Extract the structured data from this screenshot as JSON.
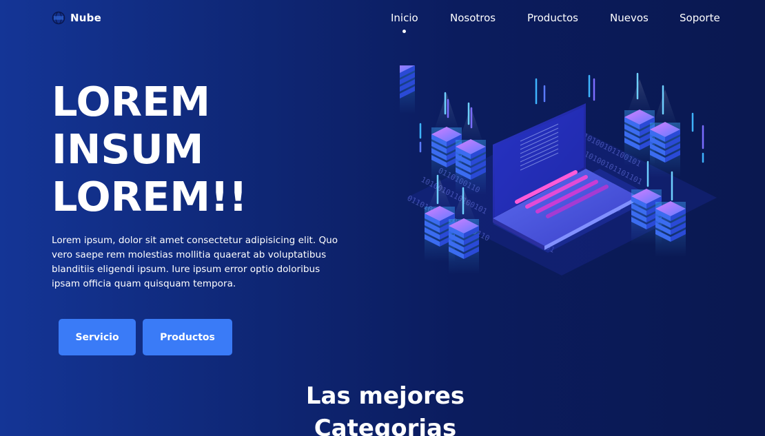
{
  "brand": {
    "name": "Nube",
    "icon": "globe-server-icon"
  },
  "nav": {
    "items": [
      {
        "label": "Inicio",
        "active": true
      },
      {
        "label": "Nosotros",
        "active": false
      },
      {
        "label": "Productos",
        "active": false
      },
      {
        "label": "Nuevos",
        "active": false
      },
      {
        "label": "Soporte",
        "active": false
      }
    ]
  },
  "hero": {
    "title_lines": [
      "LOREM",
      "INSUM",
      "LOREM!!"
    ],
    "text": "Lorem ipsum, dolor sit amet consectetur adipisicing elit. Quo vero saepe rem molestias mollitia quaerat ab voluptatibus blanditiis eligendi ipsum. Iure ipsum error optio doloribus ipsam officia quam quisquam tempora.",
    "buttons": {
      "primary": "Servicio",
      "secondary": "Productos"
    },
    "illustration": "isometric-cloud-servers-laptop-illustration"
  },
  "section": {
    "title_lines": [
      "Las mejores",
      "Categorias"
    ]
  },
  "colors": {
    "background_left": "#143596",
    "background_right": "#0a1850",
    "button": "#3a7bf7",
    "text": "#ffffff"
  }
}
